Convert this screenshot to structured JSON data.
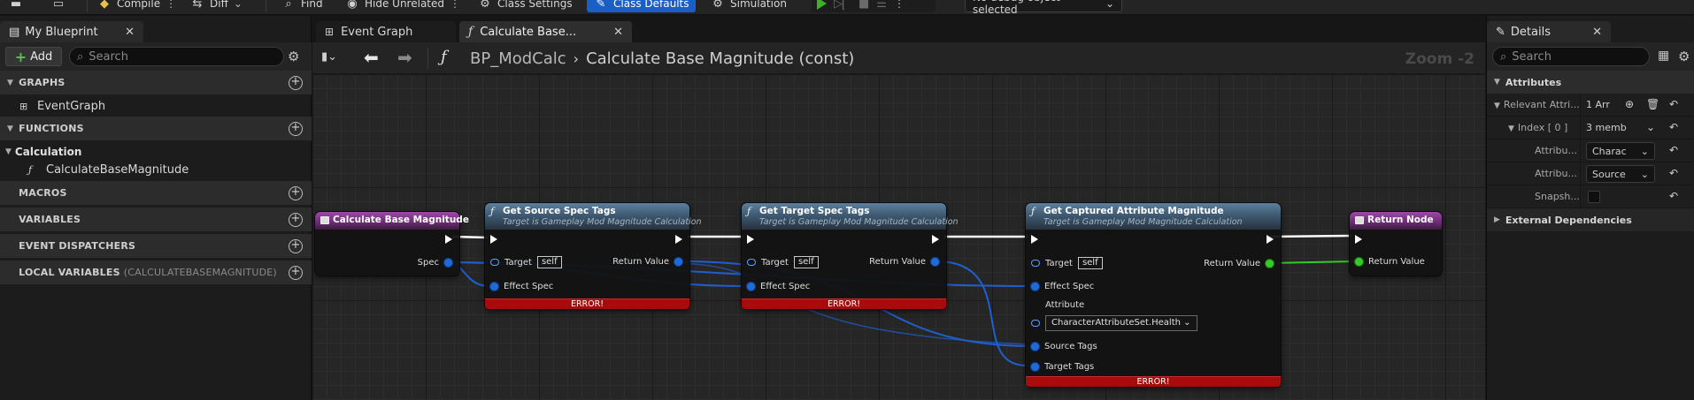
{
  "toolbar": {
    "compile_label": "Compile",
    "diff_label": "Diff",
    "find_label": "Find",
    "hide_unrelated_label": "Hide Unrelated",
    "class_settings_label": "Class Settings",
    "class_defaults_label": "Class Defaults",
    "simulation_label": "Simulation",
    "debug_object_label": "No debug object selected",
    "accent_color": "#1a5fc4",
    "play_color": "#3fb02a"
  },
  "my_blueprint": {
    "tab_label": "My Blueprint",
    "add_label": "Add",
    "search_placeholder": "Search",
    "sections": {
      "graphs": "GRAPHS",
      "functions": "FUNCTIONS",
      "macros": "MACROS",
      "variables": "VARIABLES",
      "event_dispatchers": "EVENT DISPATCHERS",
      "local_variables": "LOCAL VARIABLES",
      "local_variables_scope": "(CALCULATEBASEMAGNITUDE)"
    },
    "graph_items": [
      "EventGraph"
    ],
    "function_category": "Calculation",
    "function_items": [
      "CalculateBaseMagnitude"
    ]
  },
  "graph": {
    "tabs": [
      {
        "label": "Event Graph",
        "icon": "grid-icon"
      },
      {
        "label": "Calculate Base...",
        "icon": "function-icon"
      }
    ],
    "breadcrumb": {
      "root": "BP_ModCalc",
      "current": "Calculate Base Magnitude (const)"
    },
    "zoom_label": "Zoom -2",
    "nodes": {
      "entry": {
        "title": "Calculate Base Magnitude",
        "pin_spec": "Spec"
      },
      "source_tags": {
        "title": "Get Source Spec Tags",
        "subtitle": "Target is Gameplay Mod Magnitude Calculation",
        "pin_target": "Target",
        "target_value": "self",
        "pin_effect_spec": "Effect Spec",
        "pin_return": "Return Value",
        "error": "ERROR!"
      },
      "target_tags": {
        "title": "Get Target Spec Tags",
        "subtitle": "Target is Gameplay Mod Magnitude Calculation",
        "pin_target": "Target",
        "target_value": "self",
        "pin_effect_spec": "Effect Spec",
        "pin_return": "Return Value",
        "error": "ERROR!"
      },
      "captured": {
        "title": "Get Captured Attribute Magnitude",
        "subtitle": "Target is Gameplay Mod Magnitude Calculation",
        "pin_target": "Target",
        "target_value": "self",
        "pin_effect_spec": "Effect Spec",
        "pin_attribute": "Attribute",
        "attribute_value": "CharacterAttributeSet.Health",
        "pin_source_tags": "Source Tags",
        "pin_target_tags": "Target Tags",
        "pin_return": "Return Value",
        "error": "ERROR!"
      },
      "return": {
        "title": "Return Node",
        "pin_return": "Return Value"
      }
    }
  },
  "details": {
    "tab_label": "Details",
    "search_placeholder": "Search",
    "attributes_section": "Attributes",
    "relevant_label": "Relevant Attri...",
    "relevant_value": "1 Arr",
    "index_label": "Index [ 0 ]",
    "index_value": "3 memb",
    "attribute_label": "Attribu...",
    "attribute_value": "Charac",
    "attribute_source_label": "Attribu...",
    "attribute_source_value": "Source",
    "snapshot_label": "Snapsh...",
    "external_section": "External Dependencies"
  }
}
